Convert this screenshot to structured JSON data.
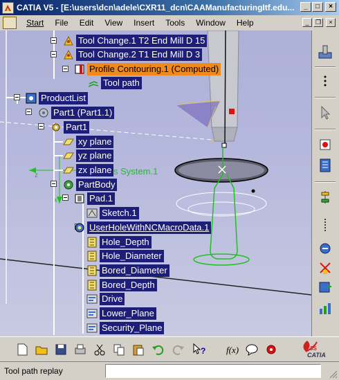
{
  "window": {
    "title": "CATIA V5 - [E:\\users\\dcn\\adele\\CXR11_dcn\\CAAManufacturingItf.edu...",
    "minimize": "_",
    "maximize": "□",
    "close": "×"
  },
  "menu": {
    "items": [
      "Start",
      "File",
      "Edit",
      "View",
      "Insert",
      "Tools",
      "Window",
      "Help"
    ],
    "mdi_minimize": "_",
    "mdi_restore": "❐",
    "mdi_close": "×"
  },
  "tree": {
    "tool_change_1": "Tool Change.1  T2 End Mill D 15",
    "tool_change_2": "Tool Change.2  T1 End Mill D 3",
    "profile_contouring": "Profile Contouring.1 (Computed)",
    "tool_path": "Tool path",
    "product_list": "ProductList",
    "part1_instance": "Part1 (Part1.1)",
    "part1": "Part1",
    "xy_plane": "xy plane",
    "yz_plane": "yz plane",
    "zx_plane": "zx plane",
    "partbody": "PartBody",
    "pad1": "Pad.1",
    "sketch1": "Sketch.1",
    "user_hole": "UserHoleWithNCMacroData.1",
    "hole_depth": "Hole_Depth",
    "hole_diameter": "Hole_Diameter",
    "bored_diameter": "Bored_Diameter",
    "bored_depth": "Bored_Depth",
    "drive": "Drive",
    "lower_plane": "Lower_Plane",
    "security_plane": "Security_Plane"
  },
  "viewport_overlay": {
    "axis_system_label": "s System.1"
  },
  "status": {
    "message": "Tool path replay",
    "command_input_value": ""
  },
  "brand": {
    "logo_text": "CATIA"
  },
  "colors": {
    "tree_label_bg": "#1c1e78",
    "selected_label_bg": "#f08a1c",
    "viewport_bg": "#b5b8dc"
  }
}
